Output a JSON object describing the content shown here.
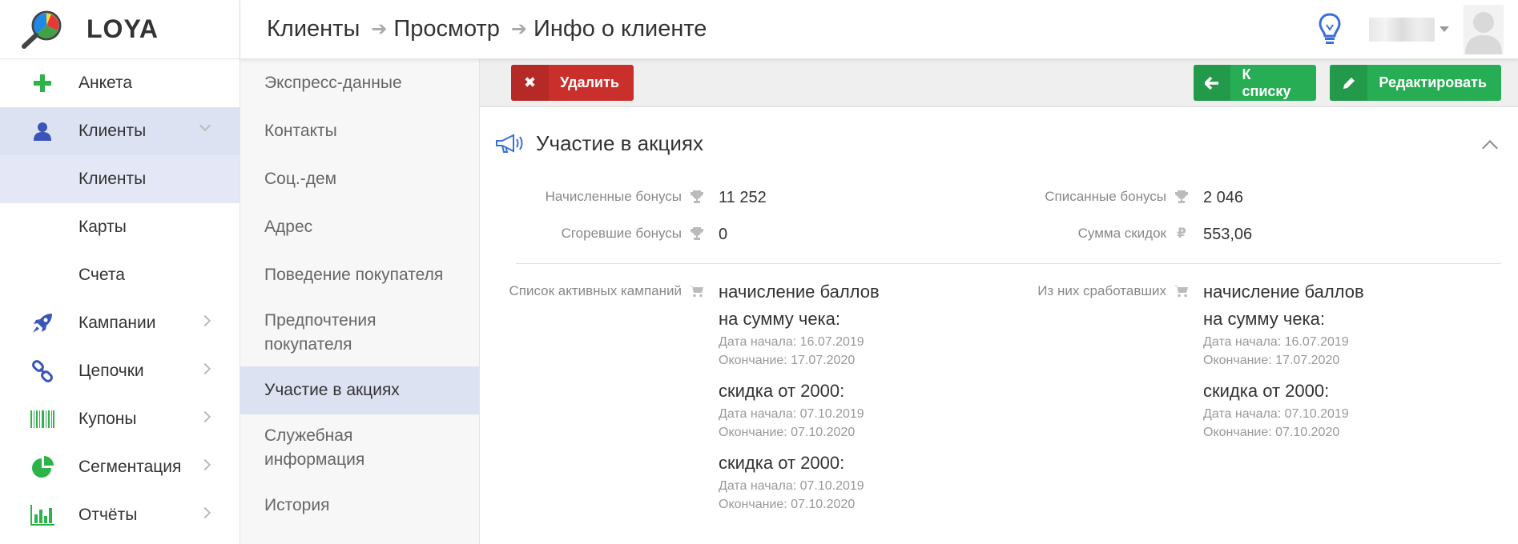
{
  "app": {
    "brand": "LOYA"
  },
  "header": {
    "breadcrumb": [
      "Клиенты",
      "Просмотр",
      "Инфо о клиенте"
    ]
  },
  "sidebar": {
    "items": [
      {
        "label": "Анкета",
        "icon": "plus-icon"
      },
      {
        "label": "Клиенты",
        "icon": "user-icon",
        "active": true
      },
      {
        "label": "Клиенты",
        "sub": true,
        "active": true
      },
      {
        "label": "Карты",
        "sub": true
      },
      {
        "label": "Счета",
        "sub": true
      },
      {
        "label": "Кампании",
        "icon": "rocket-icon"
      },
      {
        "label": "Цепочки",
        "icon": "chain-icon"
      },
      {
        "label": "Купоны",
        "icon": "barcode-icon"
      },
      {
        "label": "Сегментация",
        "icon": "pie-chart-icon"
      },
      {
        "label": "Отчёты",
        "icon": "bar-chart-icon"
      }
    ]
  },
  "sections": {
    "items": [
      "Экспресс-данные",
      "Контакты",
      "Соц.-дем",
      "Адрес",
      "Поведение покупателя",
      "Предпочтения покупателя",
      "Участие в акциях",
      "Служебная информация",
      "История"
    ],
    "active": "Участие в акциях"
  },
  "toolbar": {
    "delete_label": "Удалить",
    "back_label": "К списку",
    "edit_label": "Редактировать"
  },
  "panel": {
    "title": "Участие в акциях",
    "accrued_label": "Начисленные бонусы",
    "accrued_value": "11 252",
    "spent_label": "Списанные бонусы",
    "spent_value": "2 046",
    "burned_label": "Сгоревшие бонусы",
    "burned_value": "0",
    "discount_label": "Сумма скидок",
    "discount_value": "553,06",
    "active_label": "Список активных кампаний",
    "triggered_label": "Из них сработавших",
    "active_campaigns": [
      {
        "name": "начисление баллов на сумму чека:",
        "start": "Дата начала: 16.07.2019",
        "end": "Окончание: 17.07.2020"
      },
      {
        "name": "скидка от 2000:",
        "start": "Дата начала: 07.10.2019",
        "end": "Окончание: 07.10.2020"
      },
      {
        "name": "скидка от 2000:",
        "start": "Дата начала: 07.10.2019",
        "end": "Окончание: 07.10.2020"
      }
    ],
    "triggered_campaigns": [
      {
        "name": "начисление баллов на сумму чека:",
        "start": "Дата начала: 16.07.2019",
        "end": "Окончание: 17.07.2020"
      },
      {
        "name": "скидка от 2000:",
        "start": "Дата начала: 07.10.2019",
        "end": "Окончание: 07.10.2020"
      }
    ]
  },
  "colors": {
    "accent_blue": "#3a55b8",
    "green": "#27ae55",
    "red": "#c9302c",
    "active_bg": "#dde2f3"
  }
}
